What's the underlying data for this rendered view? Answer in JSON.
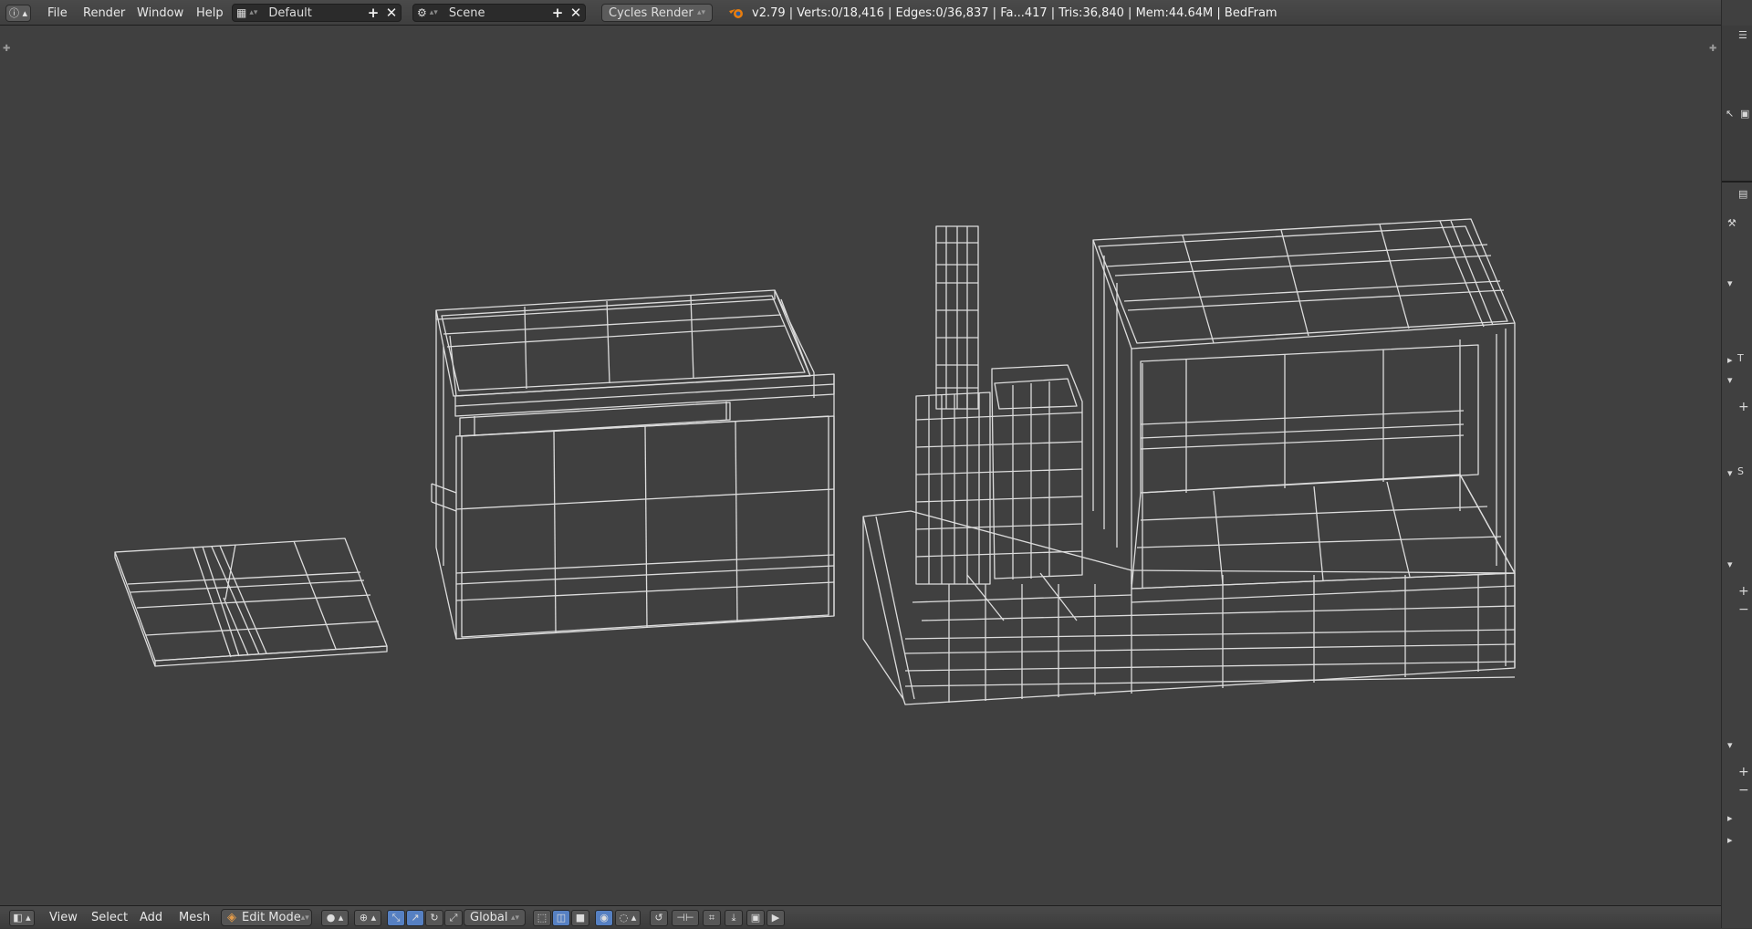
{
  "header": {
    "editor_icon": "info-icon",
    "menus": [
      "File",
      "Render",
      "Window",
      "Help"
    ],
    "screen_layout": "Default",
    "scene": "Scene",
    "render_engine": "Cycles Render",
    "stats": "v2.79 | Verts:0/18,416 | Edges:0/36,837 | Fa...417 | Tris:36,840 | Mem:44.64M | BedFram"
  },
  "viewport": {
    "background": "#404040",
    "wire_color": "#e0e0e0"
  },
  "footer": {
    "menus": [
      "View",
      "Select",
      "Add",
      "Mesh"
    ],
    "mode": "Edit Mode",
    "orientation": "Global"
  },
  "right_panel": {
    "glyphs": [
      "T",
      "S"
    ]
  }
}
